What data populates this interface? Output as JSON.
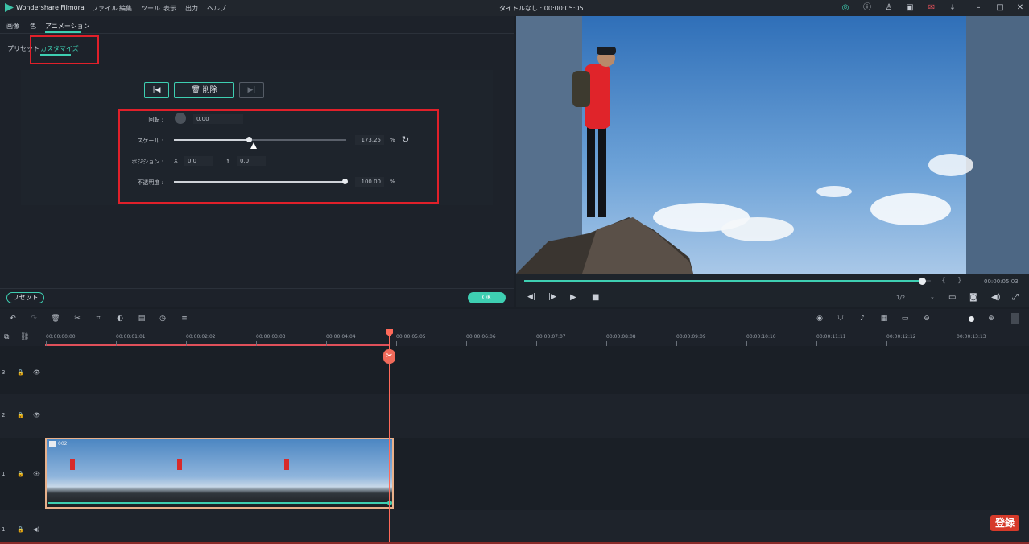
{
  "app": {
    "name": "Wondershare Filmora",
    "doc_title": "タイトルなし : 00:00:05:05"
  },
  "menu": [
    "ファイル",
    "編集",
    "ツール",
    "表示",
    "出力",
    "ヘルプ"
  ],
  "tabs": [
    "画像",
    "色",
    "アニメーション"
  ],
  "subtabs": [
    "プリセット",
    "カスタマイズ"
  ],
  "keyframe": {
    "delete_label": "削除"
  },
  "params": {
    "rotate_label": "回転 :",
    "rotate_value": "0.00",
    "scale_label": "スケール :",
    "scale_value": "173.25",
    "scale_unit": "%",
    "position_label": "ポジション :",
    "x_label": "X",
    "x_value": "0.0",
    "y_label": "Y",
    "y_value": "0.0",
    "opacity_label": "不透明度 :",
    "opacity_value": "100.00",
    "opacity_unit": "%"
  },
  "buttons": {
    "reset": "リセット",
    "ok": "OK"
  },
  "preview": {
    "progress": 0.97,
    "timecode": "00:00:05:03",
    "quality": "1/2"
  },
  "timeline": {
    "ticks": [
      "00:00:00:00",
      "00:00:01:01",
      "00:00:02:02",
      "00:00:03:03",
      "00:00:04:04",
      "00:00:05:05",
      "00:00:06:06",
      "00:00:07:07",
      "00:00:08:08",
      "00:00:09:09",
      "00:00:10:10",
      "00:00:11:11",
      "00:00:12:12",
      "00:00:13:13"
    ],
    "clip_name": "002",
    "tracks": [
      "3",
      "2",
      "1",
      "1"
    ]
  },
  "badge": "登録",
  "colors": {
    "accent": "#3ecfb2",
    "playhead": "#ff6a5a",
    "highlight": "#e0202a"
  }
}
